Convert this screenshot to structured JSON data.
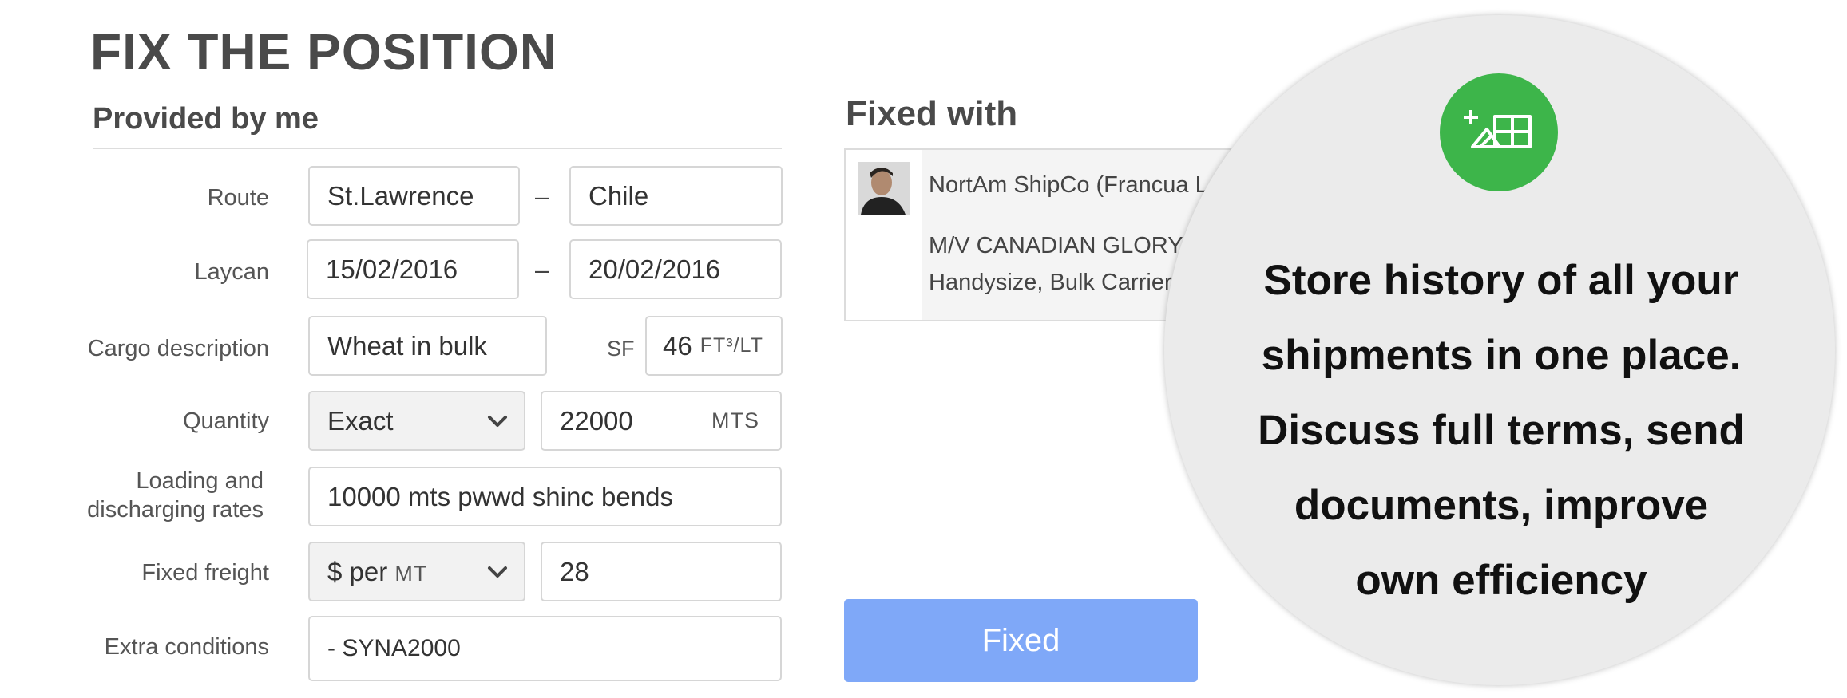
{
  "page_title": "FIX THE POSITION",
  "provided_section": {
    "title": "Provided by me",
    "route": {
      "label": "Route",
      "from": "St.Lawrence",
      "separator": "–",
      "to": "Chile"
    },
    "laycan": {
      "label": "Laycan",
      "from": "15/02/2016",
      "separator": "–",
      "to": "20/02/2016"
    },
    "cargo": {
      "label": "Cargo description",
      "value": "Wheat in bulk",
      "sf_label": "SF",
      "sf_value": "46",
      "sf_unit": "FT³/LT"
    },
    "quantity": {
      "label": "Quantity",
      "type": "Exact",
      "value": "22000",
      "unit": "MTS"
    },
    "rates": {
      "label_line1": "Loading and",
      "label_line2": "discharging rates",
      "value": "10000 mts pwwd shinc bends"
    },
    "freight": {
      "label": "Fixed freight",
      "unit_prefix": "$ per",
      "unit_suffix": "MT",
      "value": "28"
    },
    "extra": {
      "label": "Extra conditions",
      "value": "- SYNA2000"
    }
  },
  "fixed_with": {
    "title": "Fixed with",
    "company": "NortAm ShipCo (Francua Le",
    "vessel": "M/V CANADIAN GLORY",
    "vessel_type": "Handysize, Bulk Carrier"
  },
  "fixed_button": "Fixed",
  "promo": {
    "line1": "Store history of all your",
    "line2": "shipments in one place.",
    "line3": "Discuss full terms, send",
    "line4": "documents, improve",
    "line5": "own efficiency",
    "icon": "add-grid-icon",
    "badge_color": "#3db54a"
  }
}
